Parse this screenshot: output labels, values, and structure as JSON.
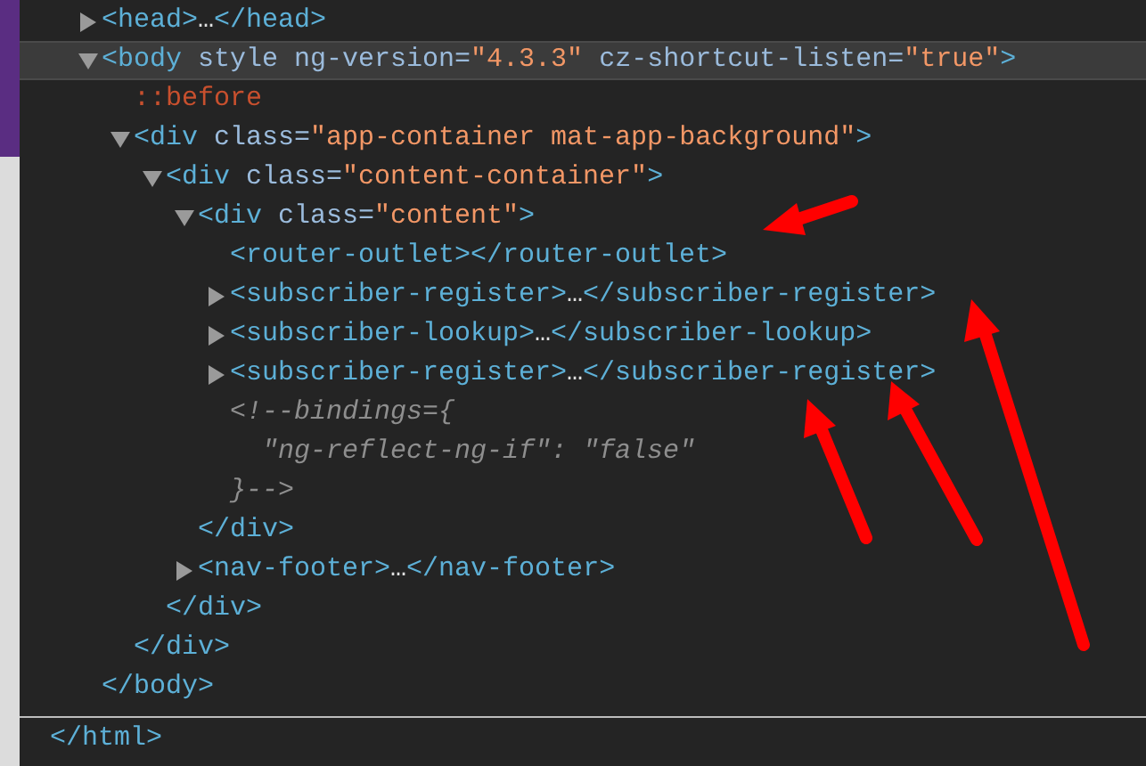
{
  "dom_tree": {
    "nodes": [
      {
        "selected": false,
        "expanded": false,
        "line": [
          {
            "text": "<head>",
            "kind": "tag"
          },
          {
            "text": "…",
            "kind": "ellipsis"
          },
          {
            "text": "</head>",
            "kind": "tag"
          }
        ]
      },
      {
        "selected": true,
        "expanded": true,
        "line": [
          {
            "text": "<body",
            "kind": "tag"
          },
          {
            "text": " style ng-version=",
            "kind": "attr"
          },
          {
            "text": "\"4.3.3\"",
            "kind": "value"
          },
          {
            "text": " cz-shortcut-listen=",
            "kind": "attr"
          },
          {
            "text": "\"true\"",
            "kind": "value"
          },
          {
            "text": ">",
            "kind": "tag"
          }
        ],
        "close": [
          {
            "text": "</body>",
            "kind": "tag"
          }
        ],
        "children": [
          {
            "selected": false,
            "line": [
              {
                "text": "::before",
                "kind": "pseudo"
              }
            ]
          },
          {
            "selected": false,
            "expanded": true,
            "line": [
              {
                "text": "<div",
                "kind": "tag"
              },
              {
                "text": " class=",
                "kind": "attr"
              },
              {
                "text": "\"app-container mat-app-background\"",
                "kind": "value"
              },
              {
                "text": ">",
                "kind": "tag"
              }
            ],
            "close": [
              {
                "text": "</div>",
                "kind": "tag"
              }
            ],
            "children": [
              {
                "selected": false,
                "expanded": true,
                "line": [
                  {
                    "text": "<div",
                    "kind": "tag"
                  },
                  {
                    "text": " class=",
                    "kind": "attr"
                  },
                  {
                    "text": "\"content-container\"",
                    "kind": "value"
                  },
                  {
                    "text": ">",
                    "kind": "tag"
                  }
                ],
                "close": [
                  {
                    "text": "</div>",
                    "kind": "tag"
                  }
                ],
                "children": [
                  {
                    "selected": false,
                    "expanded": true,
                    "line": [
                      {
                        "text": "<div",
                        "kind": "tag"
                      },
                      {
                        "text": " class=",
                        "kind": "attr"
                      },
                      {
                        "text": "\"content\"",
                        "kind": "value"
                      },
                      {
                        "text": ">",
                        "kind": "tag"
                      }
                    ],
                    "close": [
                      {
                        "text": "</div>",
                        "kind": "tag"
                      }
                    ],
                    "children": [
                      {
                        "selected": false,
                        "line": [
                          {
                            "text": "<router-outlet></router-outlet>",
                            "kind": "tag"
                          }
                        ]
                      },
                      {
                        "selected": false,
                        "expanded": false,
                        "line": [
                          {
                            "text": "<subscriber-register>",
                            "kind": "tag"
                          },
                          {
                            "text": "…",
                            "kind": "ellipsis"
                          },
                          {
                            "text": "</subscriber-register>",
                            "kind": "tag"
                          }
                        ]
                      },
                      {
                        "selected": false,
                        "expanded": false,
                        "line": [
                          {
                            "text": "<subscriber-lookup>",
                            "kind": "tag"
                          },
                          {
                            "text": "…",
                            "kind": "ellipsis"
                          },
                          {
                            "text": "</subscriber-lookup>",
                            "kind": "tag"
                          }
                        ]
                      },
                      {
                        "selected": false,
                        "expanded": false,
                        "line": [
                          {
                            "text": "<subscriber-register>",
                            "kind": "tag"
                          },
                          {
                            "text": "…",
                            "kind": "ellipsis"
                          },
                          {
                            "text": "</subscriber-register>",
                            "kind": "tag"
                          }
                        ]
                      },
                      {
                        "selected": false,
                        "lines": [
                          "<!--bindings={",
                          "  \"ng-reflect-ng-if\": \"false\"",
                          "}-->"
                        ]
                      }
                    ]
                  },
                  {
                    "selected": false,
                    "expanded": false,
                    "line": [
                      {
                        "text": "<nav-footer>",
                        "kind": "tag"
                      },
                      {
                        "text": "…",
                        "kind": "ellipsis"
                      },
                      {
                        "text": "</nav-footer>",
                        "kind": "tag"
                      }
                    ]
                  }
                ]
              }
            ]
          }
        ]
      }
    ],
    "footer": [
      {
        "text": "</html>",
        "kind": "tag"
      }
    ]
  }
}
